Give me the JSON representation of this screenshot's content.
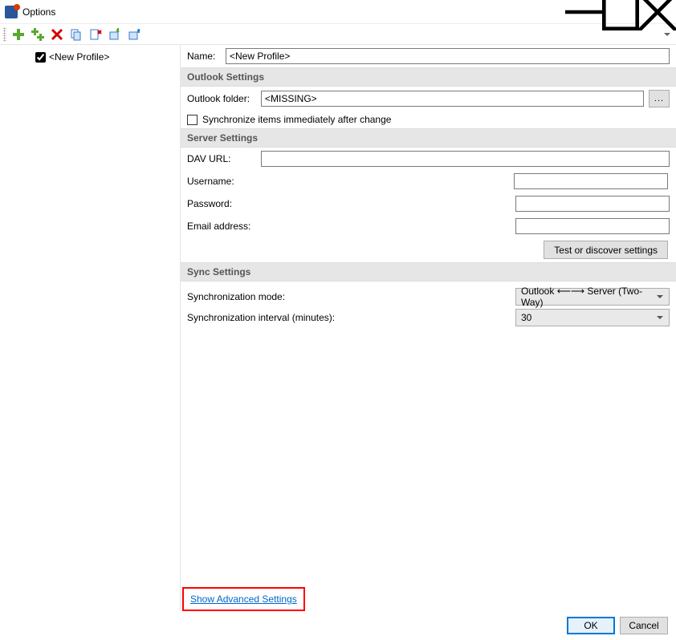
{
  "window": {
    "title": "Options"
  },
  "toolbar": {
    "buttons": [
      "add",
      "add-multi",
      "delete",
      "copy",
      "paste",
      "import",
      "export"
    ]
  },
  "tree": {
    "item_label": "<New Profile>",
    "item_checked": true
  },
  "form": {
    "name_label": "Name:",
    "name_value": "<New Profile>",
    "section_outlook": "Outlook Settings",
    "outlook_folder_label": "Outlook folder:",
    "outlook_folder_value": "<MISSING>",
    "browse_label": "...",
    "sync_immediate_label": "Synchronize items immediately after change",
    "section_server": "Server Settings",
    "dav_label": "DAV URL:",
    "dav_value": "",
    "username_label": "Username:",
    "username_value": "",
    "password_label": "Password:",
    "password_value": "",
    "email_label": "Email address:",
    "email_value": "",
    "test_button": "Test or discover settings",
    "section_sync": "Sync Settings",
    "sync_mode_label": "Synchronization mode:",
    "sync_mode_value": "Outlook ⟵⟶ Server (Two-Way)",
    "sync_interval_label": "Synchronization interval (minutes):",
    "sync_interval_value": "30",
    "advanced_link": "Show Advanced Settings"
  },
  "buttons": {
    "ok": "OK",
    "cancel": "Cancel"
  }
}
